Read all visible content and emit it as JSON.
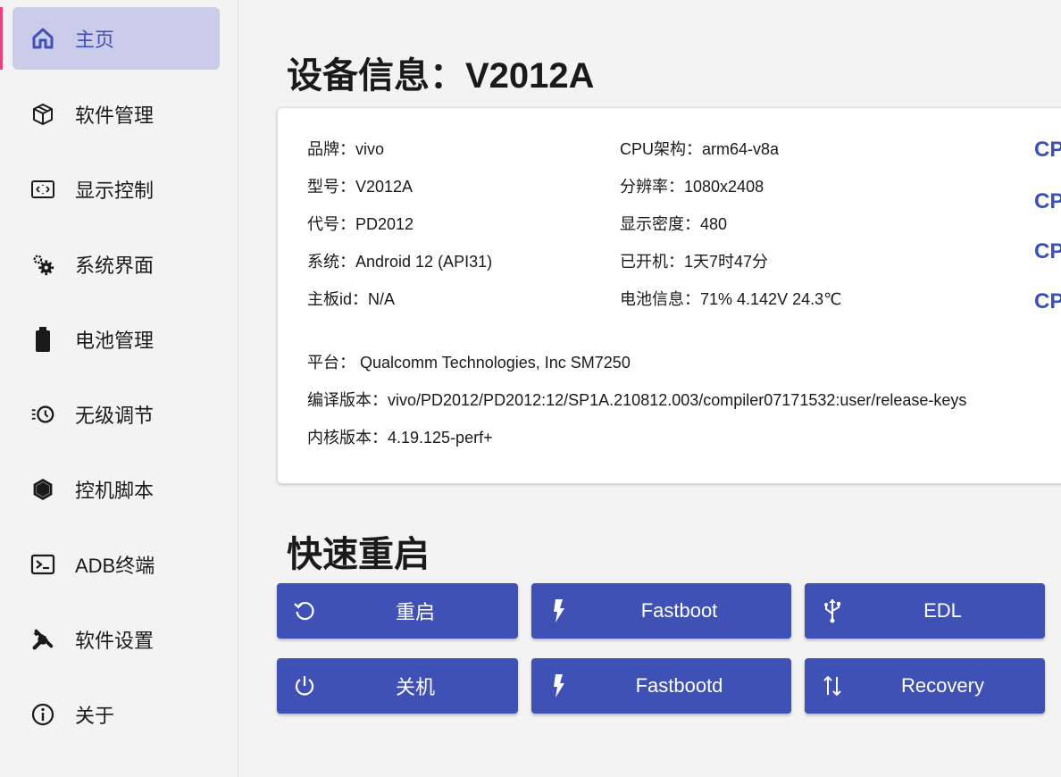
{
  "sidebar": {
    "items": [
      {
        "label": "主页",
        "icon": "home-icon",
        "active": true
      },
      {
        "label": "软件管理",
        "icon": "package-icon"
      },
      {
        "label": "显示控制",
        "icon": "screen-icon"
      },
      {
        "label": "系统界面",
        "icon": "gears-icon"
      },
      {
        "label": "电池管理",
        "icon": "battery-icon"
      },
      {
        "label": "无级调节",
        "icon": "adjust-clock-icon"
      },
      {
        "label": "控机脚本",
        "icon": "hexagon-icon"
      },
      {
        "label": "ADB终端",
        "icon": "terminal-icon"
      },
      {
        "label": "软件设置",
        "icon": "tools-icon"
      },
      {
        "label": "关于",
        "icon": "info-icon"
      }
    ]
  },
  "device": {
    "title": "设备信息：V2012A",
    "left_col": [
      "品牌：vivo",
      "型号：V2012A",
      "代号：PD2012",
      "系统：Android 12 (API31)",
      "主板id：N/A"
    ],
    "right_col": [
      "CPU架构：arm64-v8a",
      "分辨率：1080x2408",
      "显示密度：480",
      "已开机：1天7时47分",
      "电池信息：71%  4.142V  24.3℃"
    ],
    "cpu_labels": [
      "CPU",
      "CPU",
      "CPU",
      "CPU"
    ],
    "platform": "平台： Qualcomm Technologies, Inc SM7250",
    "build": "编译版本：vivo/PD2012/PD2012:12/SP1A.210812.003/compiler07171532:user/release-keys",
    "kernel": "内核版本：4.19.125-perf+"
  },
  "reboot": {
    "title": "快速重启",
    "buttons": [
      {
        "label": "重启",
        "icon": "restart-icon"
      },
      {
        "label": "Fastboot",
        "icon": "bolt-icon"
      },
      {
        "label": "EDL",
        "icon": "usb-icon"
      },
      {
        "label": "关机",
        "icon": "power-icon"
      },
      {
        "label": "Fastbootd",
        "icon": "bolt-icon"
      },
      {
        "label": "Recovery",
        "icon": "arrows-updown-icon"
      }
    ]
  },
  "colors": {
    "accent": "#3f51b5",
    "sidebar_active": "#cbcbea",
    "active_marker": "#e8427a",
    "cpu_text": "#3b51b3"
  }
}
